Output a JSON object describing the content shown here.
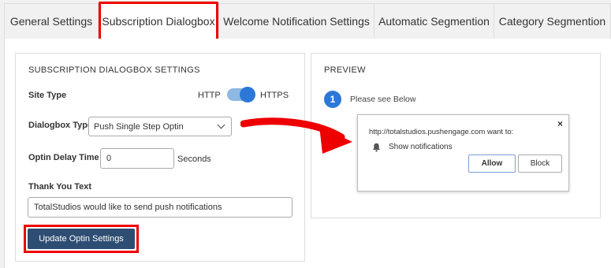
{
  "tabs": [
    {
      "label": "General Settings"
    },
    {
      "label": "Subscription Dialogbox"
    },
    {
      "label": "Welcome Notification Settings"
    },
    {
      "label": "Automatic Segmention"
    },
    {
      "label": "Category Segmention"
    }
  ],
  "settings": {
    "title": "SUBSCRIPTION DIALOGBOX SETTINGS",
    "site_type_label": "Site Type",
    "http_label": "HTTP",
    "https_label": "HTTPS",
    "site_type_https_on": true,
    "dialogbox_type_label": "Dialogbox Type",
    "dialogbox_type_value": "Push Single Step Optin",
    "optin_delay_label": "Optin Delay Time",
    "optin_delay_value": "0",
    "optin_delay_unit": "Seconds",
    "thank_you_label": "Thank You Text",
    "thank_you_value": "TotalStudios would like to send push notifications",
    "update_button": "Update Optin Settings"
  },
  "preview": {
    "title": "PREVIEW",
    "step_number": "1",
    "step_text": "Please see Below",
    "popup_url": "http://totalstudios.pushengage.com want to:",
    "popup_close": "×",
    "popup_notification": "Show notifications",
    "allow_button": "Allow",
    "block_button": "Block"
  },
  "colors": {
    "highlight": "#e00000",
    "primary_button": "#2e4d73",
    "toggle": "#2c78d8"
  }
}
